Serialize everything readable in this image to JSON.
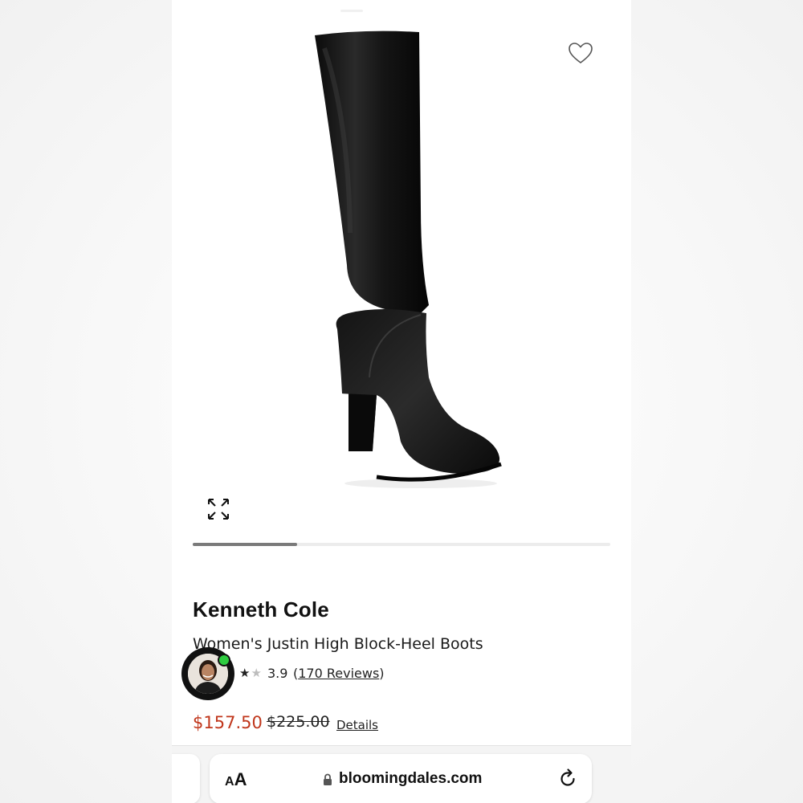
{
  "browser": {
    "url": "bloomingdales.com",
    "text_size_small": "A",
    "text_size_large": "A"
  },
  "icons": {
    "wishlist": "heart-outline-icon",
    "expand": "expand-arrows-icon",
    "lock": "lock-icon",
    "reload": "reload-icon"
  },
  "product": {
    "brand": "Kenneth Cole",
    "name": "Women's Justin High Block-Heel Boots",
    "rating": "3.9",
    "rating_fraction": 0.78,
    "reviews_open": "(",
    "reviews_label": "170 Reviews",
    "reviews_close": ")",
    "sale_price": "$157.50",
    "original_price": "$225.00",
    "details_label": "Details"
  },
  "carousel": {
    "image_count": 4,
    "current_index": 1
  },
  "colors": {
    "sale_price": "#c0361b",
    "online_status": "#2ecc40"
  }
}
